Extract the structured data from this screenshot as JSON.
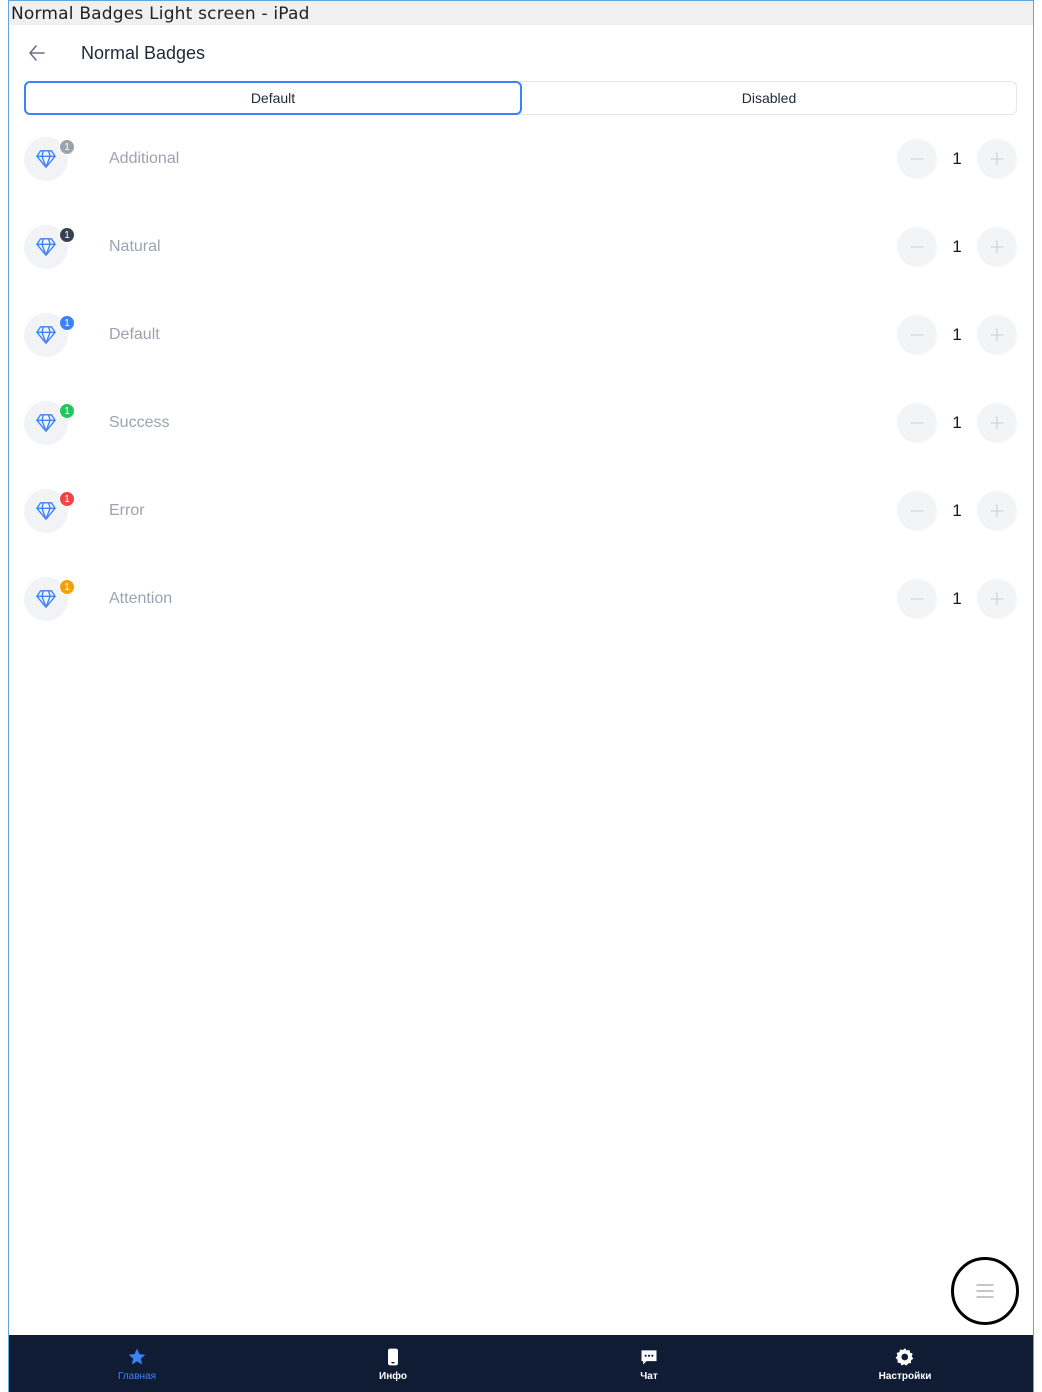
{
  "window": {
    "title": "Normal Badges Light screen - iPad"
  },
  "header": {
    "title": "Normal Badges"
  },
  "segments": [
    {
      "label": "Default",
      "active": true
    },
    {
      "label": "Disabled",
      "active": false
    }
  ],
  "rows": [
    {
      "label": "Additional",
      "badge": "1",
      "badge_color": "#9ca3af",
      "value": "1"
    },
    {
      "label": "Natural",
      "badge": "1",
      "badge_color": "#374151",
      "value": "1"
    },
    {
      "label": "Default",
      "badge": "1",
      "badge_color": "#3b82f6",
      "value": "1"
    },
    {
      "label": "Success",
      "badge": "1",
      "badge_color": "#22c55e",
      "value": "1"
    },
    {
      "label": "Error",
      "badge": "1",
      "badge_color": "#ef4444",
      "value": "1"
    },
    {
      "label": "Attention",
      "badge": "1",
      "badge_color": "#f59e0b",
      "value": "1"
    }
  ],
  "row_icon": "diamond-icon",
  "tabbar": {
    "items": [
      {
        "label": "Главная",
        "icon": "star-icon",
        "active": true
      },
      {
        "label": "Инфо",
        "icon": "phone-icon",
        "active": false
      },
      {
        "label": "Чат",
        "icon": "chat-icon",
        "active": false
      },
      {
        "label": "Настройки",
        "icon": "gear-icon",
        "active": false
      }
    ]
  },
  "colors": {
    "accent": "#3b82f6",
    "tabbar_bg": "#0f1c33"
  }
}
